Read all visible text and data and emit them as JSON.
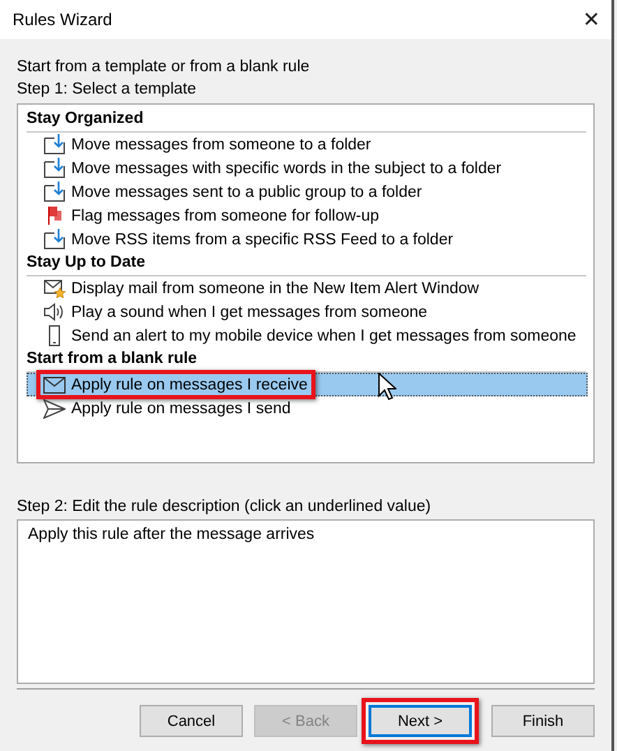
{
  "window": {
    "title": "Rules Wizard",
    "close": "✕"
  },
  "intro": "Start from a template or from a blank rule",
  "step1_label": "Step 1: Select a template",
  "groups": [
    {
      "heading": "Stay Organized",
      "items": [
        {
          "label": "Move messages from someone to a folder",
          "kind": "move",
          "selected": false,
          "highlighted": false
        },
        {
          "label": "Move messages with specific words in the subject to a folder",
          "kind": "move",
          "selected": false,
          "highlighted": false
        },
        {
          "label": "Move messages sent to a public group to a folder",
          "kind": "move",
          "selected": false,
          "highlighted": false
        },
        {
          "label": "Flag messages from someone for follow-up",
          "kind": "flag",
          "selected": false,
          "highlighted": false
        },
        {
          "label": "Move RSS items from a specific RSS Feed to a folder",
          "kind": "move",
          "selected": false,
          "highlighted": false
        }
      ]
    },
    {
      "heading": "Stay Up to Date",
      "items": [
        {
          "label": "Display mail from someone in the New Item Alert Window",
          "kind": "alert",
          "selected": false,
          "highlighted": false
        },
        {
          "label": "Play a sound when I get messages from someone",
          "kind": "sound",
          "selected": false,
          "highlighted": false
        },
        {
          "label": "Send an alert to my mobile device when I get messages from someone",
          "kind": "mobile",
          "selected": false,
          "highlighted": false
        }
      ]
    },
    {
      "heading": "Start from a blank rule",
      "items": [
        {
          "label": "Apply rule on messages I receive",
          "kind": "receive",
          "selected": true,
          "highlighted": true
        },
        {
          "label": "Apply rule on messages I send",
          "kind": "send",
          "selected": false,
          "highlighted": false
        }
      ]
    }
  ],
  "step2_label": "Step 2: Edit the rule description (click an underlined value)",
  "description": "Apply this rule after the message arrives",
  "buttons": [
    {
      "label": "Cancel",
      "disabled": false,
      "focused": false,
      "highlighted": false
    },
    {
      "label": "< Back",
      "disabled": true,
      "focused": false,
      "highlighted": false
    },
    {
      "label": "Next >",
      "disabled": false,
      "focused": true,
      "highlighted": true
    },
    {
      "label": "Finish",
      "disabled": false,
      "focused": false,
      "highlighted": false
    }
  ]
}
